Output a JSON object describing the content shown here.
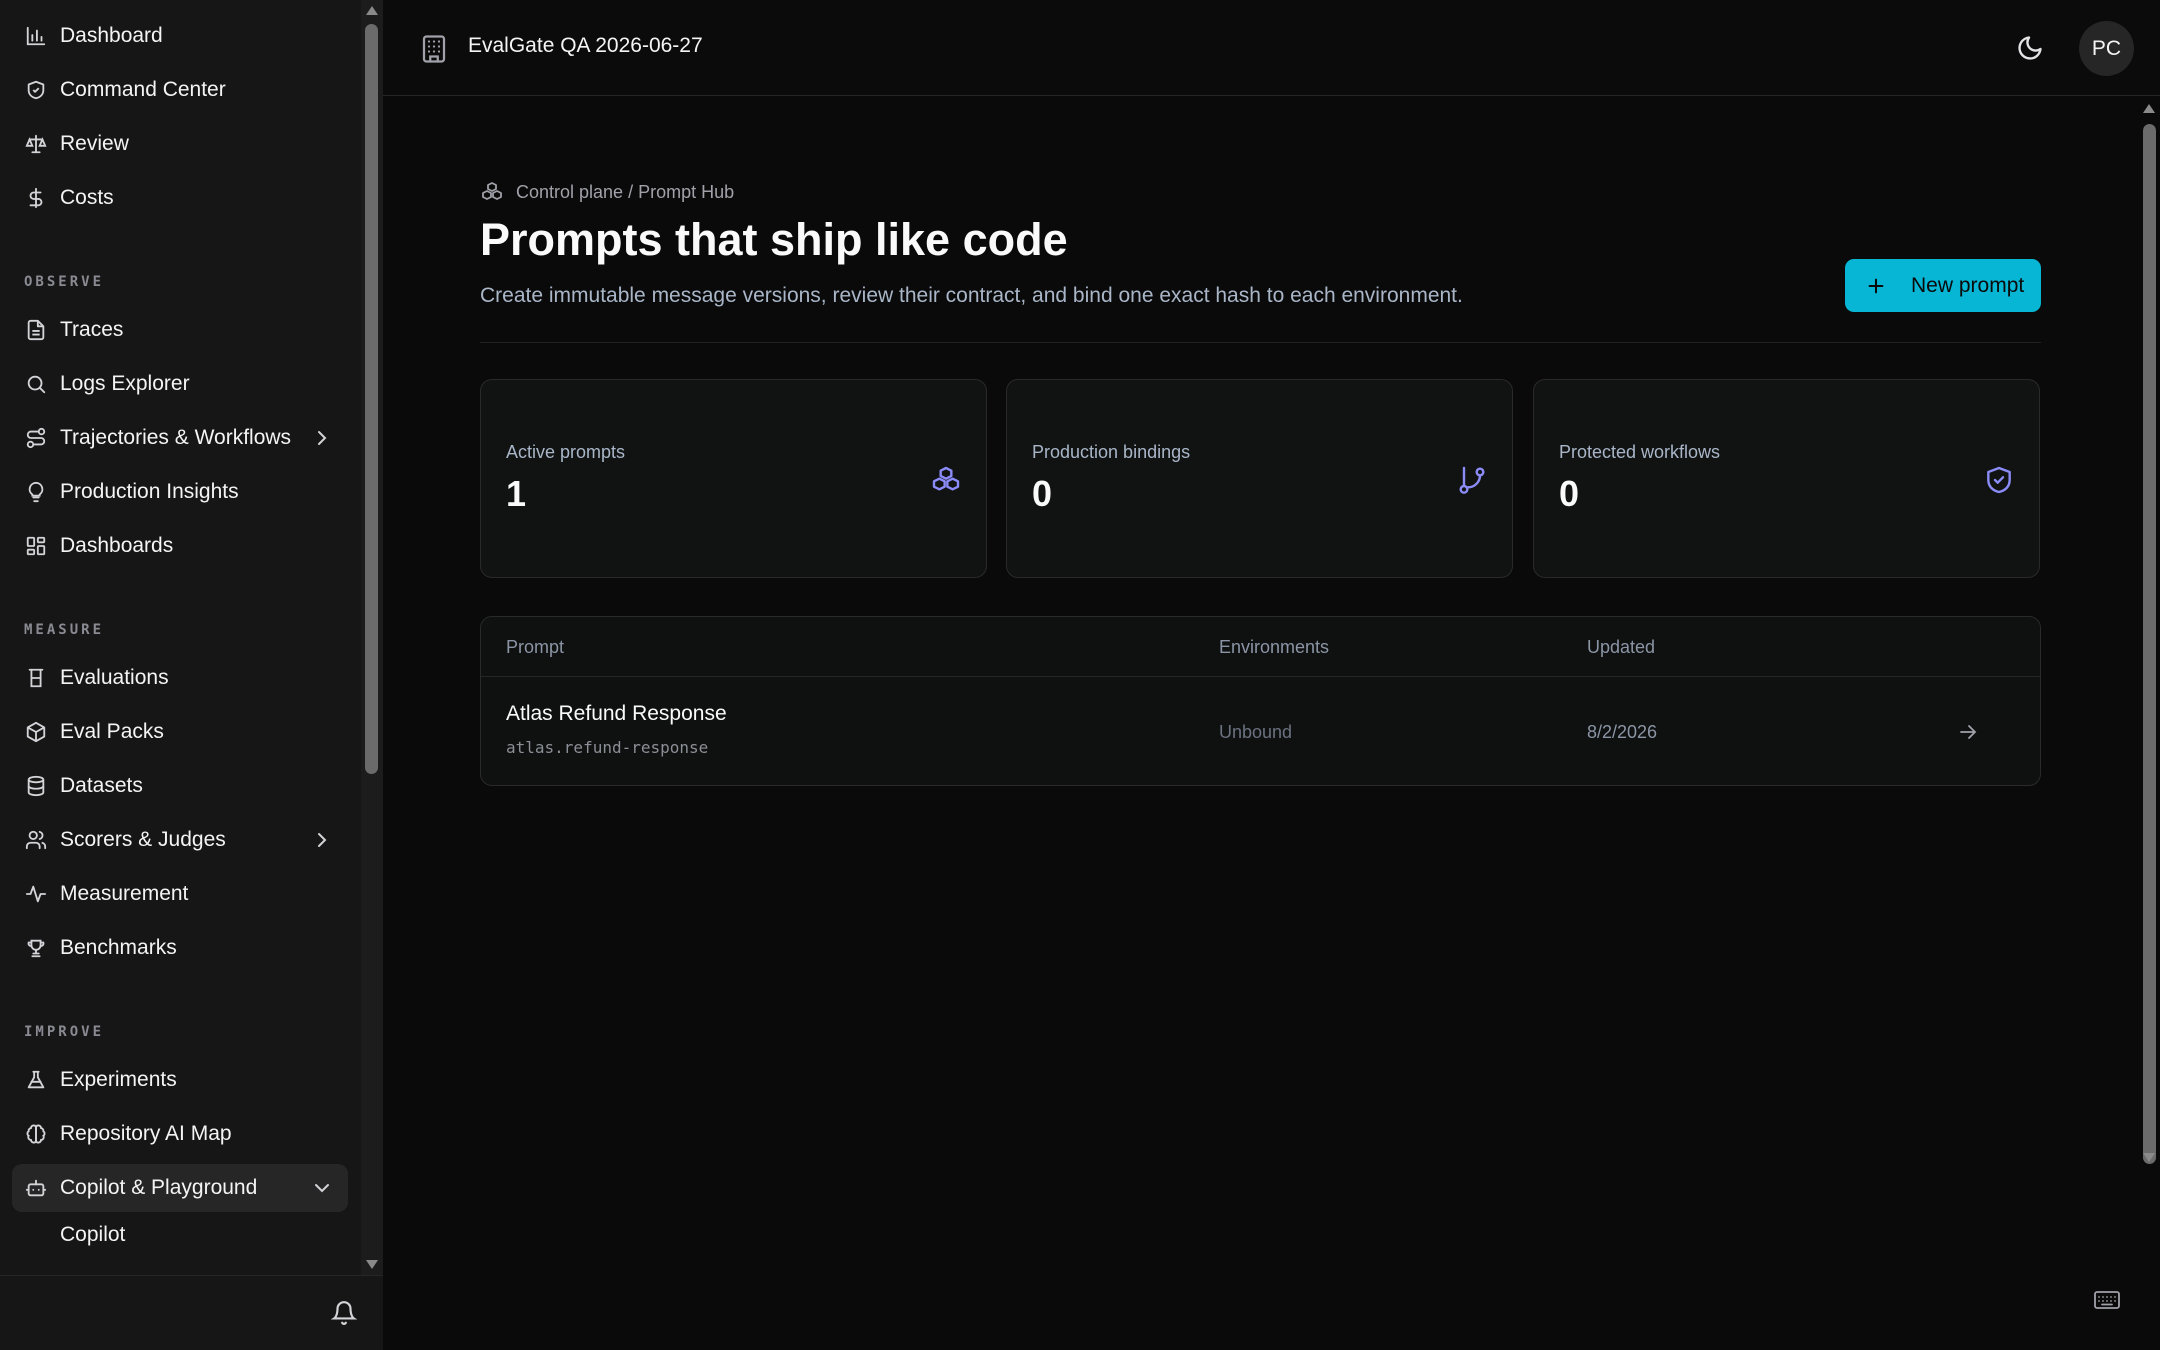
{
  "sidebar": {
    "top_items": [
      {
        "label": "Dashboard",
        "icon": "bar-chart-icon"
      },
      {
        "label": "Command Center",
        "icon": "shield-icon"
      },
      {
        "label": "Review",
        "icon": "scale-icon"
      },
      {
        "label": "Costs",
        "icon": "dollar-icon"
      }
    ],
    "sections": {
      "observe": "OBSERVE",
      "measure": "MEASURE",
      "improve": "IMPROVE"
    },
    "observe_items": [
      {
        "label": "Traces",
        "icon": "file-text-icon"
      },
      {
        "label": "Logs Explorer",
        "icon": "search-icon"
      },
      {
        "label": "Trajectories & Workflows",
        "icon": "workflow-icon"
      },
      {
        "label": "Production Insights",
        "icon": "lightbulb-icon"
      },
      {
        "label": "Dashboards",
        "icon": "layout-grid-icon"
      }
    ],
    "measure_items": [
      {
        "label": "Evaluations",
        "icon": "beaker-icon"
      },
      {
        "label": "Eval Packs",
        "icon": "package-icon"
      },
      {
        "label": "Datasets",
        "icon": "database-icon"
      },
      {
        "label": "Scorers & Judges",
        "icon": "users-icon"
      },
      {
        "label": "Measurement",
        "icon": "activity-icon"
      },
      {
        "label": "Benchmarks",
        "icon": "trophy-icon"
      }
    ],
    "improve_items": [
      {
        "label": "Experiments",
        "icon": "flask-icon"
      },
      {
        "label": "Repository AI Map",
        "icon": "brain-icon"
      },
      {
        "label": "Copilot & Playground",
        "icon": "bot-icon"
      }
    ],
    "sub_items": [
      {
        "label": "Copilot"
      }
    ]
  },
  "topbar": {
    "org_name": "EvalGate QA 2026-06-27",
    "avatar_initials": "PC"
  },
  "page": {
    "breadcrumb": "Control plane / Prompt Hub",
    "title": "Prompts that ship like code",
    "subtitle": "Create immutable message versions, review their contract, and bind one exact hash to each environment.",
    "new_button": "New prompt"
  },
  "stats": [
    {
      "label": "Active prompts",
      "value": "1",
      "icon": "boxes-icon"
    },
    {
      "label": "Production bindings",
      "value": "0",
      "icon": "git-branch-icon"
    },
    {
      "label": "Protected workflows",
      "value": "0",
      "icon": "shield-check-icon"
    }
  ],
  "table": {
    "columns": [
      "Prompt",
      "Environments",
      "Updated"
    ],
    "rows": [
      {
        "name": "Atlas Refund Response",
        "slug": "atlas.refund-response",
        "environments": "Unbound",
        "updated": "8/2/2026"
      }
    ]
  },
  "colors": {
    "accent": "#06b6d4",
    "icon_accent": "#8b8cf8",
    "background": "#0a0a0a",
    "sidebar": "#161616"
  }
}
